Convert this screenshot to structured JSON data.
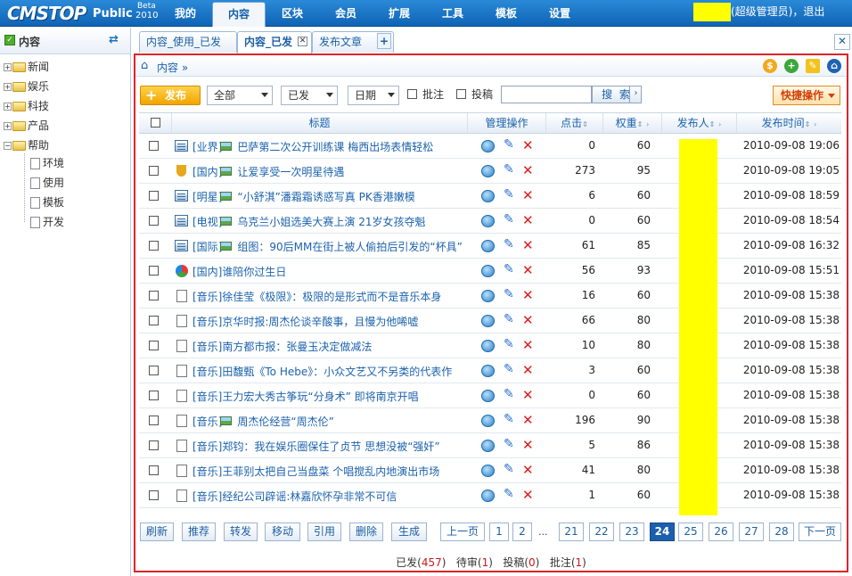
{
  "app": {
    "logo": "CMSTOP",
    "edition": "Public",
    "beta": "Beta",
    "year": "2010"
  },
  "topnav": [
    {
      "label": "我的"
    },
    {
      "label": "内容",
      "active": true
    },
    {
      "label": "区块"
    },
    {
      "label": "会员"
    },
    {
      "label": "扩展"
    },
    {
      "label": "工具"
    },
    {
      "label": "模板"
    },
    {
      "label": "设置"
    }
  ],
  "user": {
    "role_text": "(超级管理员)，退出"
  },
  "sidebar": {
    "title": "内容",
    "items": [
      {
        "label": "新闻"
      },
      {
        "label": "娱乐"
      },
      {
        "label": "科技"
      },
      {
        "label": "产品"
      },
      {
        "label": "帮助"
      }
    ],
    "children": [
      {
        "label": "环境"
      },
      {
        "label": "使用"
      },
      {
        "label": "模板"
      },
      {
        "label": "开发"
      }
    ]
  },
  "tabs": [
    {
      "label": "内容_使用_已发"
    },
    {
      "label": "内容_已发",
      "active": true
    },
    {
      "label": "发布文章"
    }
  ],
  "breadcrumb": {
    "text": "内容 »"
  },
  "toolbar": {
    "publish": "发布",
    "filter_all": "全部",
    "filter_status": "已发",
    "filter_date": "日期",
    "check_comment": "批注",
    "check_contrib": "投稿",
    "search": "搜 索",
    "quick": "快捷操作"
  },
  "table": {
    "headers": {
      "title": "标题",
      "manage": "管理操作",
      "clicks": "点击",
      "weight": "权重",
      "publisher": "发布人",
      "time": "发布时间"
    },
    "rows": [
      {
        "icon": "news",
        "cat": "[业界]",
        "pic": true,
        "title": "巴萨第二次公开训练课 梅西出场表情轻松",
        "clicks": "0",
        "weight": "60",
        "time": "2010-09-08 19:06"
      },
      {
        "icon": "trophy",
        "cat": "[国内]",
        "pic": true,
        "title": "让爱享受一次明星待遇",
        "clicks": "273",
        "weight": "95",
        "time": "2010-09-08 19:05"
      },
      {
        "icon": "news",
        "cat": "[明星]",
        "pic": true,
        "title": "“小舒淇”潘霜霜诱惑写真 PK香港嫩模",
        "clicks": "6",
        "weight": "60",
        "time": "2010-09-08 18:59"
      },
      {
        "icon": "news",
        "cat": "[电视]",
        "pic": true,
        "title": "乌克兰小姐选美大赛上演 21岁女孩夺魁",
        "clicks": "0",
        "weight": "60",
        "time": "2010-09-08 18:54"
      },
      {
        "icon": "news",
        "cat": "[国际]",
        "pic": true,
        "title": "组图：90后MM在街上被人偷拍后引发的“杯具”",
        "clicks": "61",
        "weight": "85",
        "time": "2010-09-08 16:32"
      },
      {
        "icon": "ball",
        "cat": "[国内]",
        "pic": false,
        "title": "谁陪你过生日",
        "clicks": "56",
        "weight": "93",
        "time": "2010-09-08 15:51"
      },
      {
        "icon": "doc",
        "cat": "[音乐]",
        "pic": false,
        "title": "徐佳莹《极限》：极限的是形式而不是音乐本身",
        "clicks": "16",
        "weight": "60",
        "time": "2010-09-08 15:38"
      },
      {
        "icon": "doc",
        "cat": "[音乐]",
        "pic": false,
        "title": "京华时报:周杰伦谈辛酸事，且慢为他唏嘘",
        "clicks": "66",
        "weight": "80",
        "time": "2010-09-08 15:38"
      },
      {
        "icon": "doc",
        "cat": "[音乐]",
        "pic": false,
        "title": "南方都市报：张曼玉决定做减法",
        "clicks": "10",
        "weight": "80",
        "time": "2010-09-08 15:38"
      },
      {
        "icon": "doc",
        "cat": "[音乐]",
        "pic": false,
        "title": "田馥甄《To Hebe》：小众文艺又不另类的代表作",
        "clicks": "3",
        "weight": "60",
        "time": "2010-09-08 15:38"
      },
      {
        "icon": "doc",
        "cat": "[音乐]",
        "pic": false,
        "title": "王力宏大秀古筝玩“分身术” 即将南京开唱",
        "clicks": "0",
        "weight": "60",
        "time": "2010-09-08 15:38"
      },
      {
        "icon": "doc",
        "cat": "[音乐]",
        "pic": true,
        "title": "周杰伦经营“周杰伦”",
        "clicks": "196",
        "weight": "90",
        "time": "2010-09-08 15:38"
      },
      {
        "icon": "doc",
        "cat": "[音乐]",
        "pic": false,
        "title": "郑钧：我在娱乐圈保住了贞节 思想没被“强奸”",
        "clicks": "5",
        "weight": "86",
        "time": "2010-09-08 15:38"
      },
      {
        "icon": "doc",
        "cat": "[音乐]",
        "pic": false,
        "title": "王菲别太把自己当盘菜 个唱搅乱内地演出市场",
        "clicks": "41",
        "weight": "80",
        "time": "2010-09-08 15:38"
      },
      {
        "icon": "doc",
        "cat": "[音乐]",
        "pic": false,
        "title": "经纪公司辟谣:林嘉欣怀孕非常不可信",
        "clicks": "1",
        "weight": "60",
        "time": "2010-09-08 15:38"
      }
    ]
  },
  "actions": [
    {
      "label": "刷新"
    },
    {
      "label": "推荐"
    },
    {
      "label": "转发"
    },
    {
      "label": "移动"
    },
    {
      "label": "引用"
    },
    {
      "label": "删除"
    },
    {
      "label": "生成"
    }
  ],
  "pagination": {
    "prev": "上一页",
    "next": "下一页",
    "ellipsis": "...",
    "pages": [
      "1",
      "2",
      "21",
      "22",
      "23",
      "24",
      "25",
      "26",
      "27",
      "28"
    ],
    "current": "24"
  },
  "status": {
    "published_label": "已发",
    "published": "457",
    "pending_label": "待审",
    "pending": "1",
    "contrib_label": "投稿",
    "contrib": "0",
    "comment_label": "批注",
    "comment": "1"
  }
}
